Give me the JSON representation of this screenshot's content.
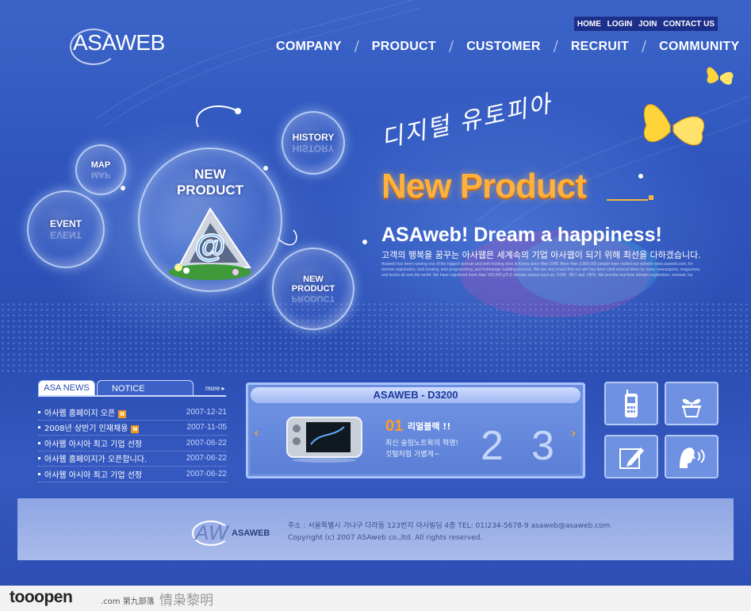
{
  "logo": {
    "text": "ASAWEB"
  },
  "util_nav": [
    "HOME",
    "LOGIN",
    "JOIN",
    "CONTACT US"
  ],
  "gnb": [
    "COMPANY",
    "PRODUCT",
    "CUSTOMER",
    "RECRUIT",
    "COMMUNITY"
  ],
  "bubbles": {
    "map": "MAP",
    "event": "EVENT",
    "history": "HISTORY",
    "new_product_main": [
      "NEW",
      "PRODUCT"
    ],
    "new_product_small": [
      "NEW",
      "PRODUCT"
    ],
    "at_sign": "@"
  },
  "hero": {
    "handwriting": "디지털 유토피아",
    "title": "New Product",
    "headline": "ASAweb! Dream a happiness!",
    "subline": "고객의 행복을 꿈꾸는 아사웹은 세계속의 기업 아사웹이 되기 위해 최선을 다하겠습니다.",
    "small_text": "Asaweb has been running one of the biggest domain and web hosting sites in Korea since May 1998. More than 3,000,000 people have visited our website www.asaweb.com, for domain registration, web hosting, web programming, and homepage building services. We are very proud that our site has been cited several times by many newspapers, magazines, and books all over the world. We have registered more than 100,000 gTLD domain names such as .COM, .NET and .ORG. We provide real-time domain registration, renewal, tra"
  },
  "news": {
    "tabs": [
      "ASA NEWS",
      "NOTICE"
    ],
    "more": "more",
    "new_badge": "N",
    "items": [
      {
        "title": "아사웹 홈페이지 오픈",
        "new": true,
        "date": "2007-12-21"
      },
      {
        "title": "2008년 상반기 인재채용",
        "new": true,
        "date": "2007-11-05"
      },
      {
        "title": "아사웹 아시아 최고 기업 선정",
        "new": false,
        "date": "2007-06-22"
      },
      {
        "title": "아사웹 홈페이지가 오픈합니다.",
        "new": false,
        "date": "2007-06-22"
      },
      {
        "title": "아사웹 아시아 최고 기업 선정",
        "new": false,
        "date": "2007-06-22"
      }
    ]
  },
  "product_box": {
    "title": "ASAWEB - D3200",
    "number": "01",
    "name": "리얼블랙 !!",
    "desc1": "최신 슬림노트북의 혁명!",
    "desc2": "깃털처럼 가볍게~",
    "page_a": "2",
    "page_b": "3",
    "prev": "‹",
    "next": "›"
  },
  "footer": {
    "logo_aw": "AW",
    "logo_text": "ASAWEB",
    "address": "주소 : 서울특별시 가나구 다라동 123번지 아사빌딩 4층 TEL: 01)234-5678-9 asaweb@asaweb.com",
    "copyright": "Copyright (c) 2007 ASAweb  co.,ltd. All rights reserved."
  },
  "watermark": {
    "brand": "tooopen",
    "domain": ".com 第九部落",
    "author": "情枭黎明"
  },
  "colors": {
    "accent_orange": "#ffb13b",
    "background_blue": "#2f55bd",
    "new_badge": "#f39b1b"
  }
}
